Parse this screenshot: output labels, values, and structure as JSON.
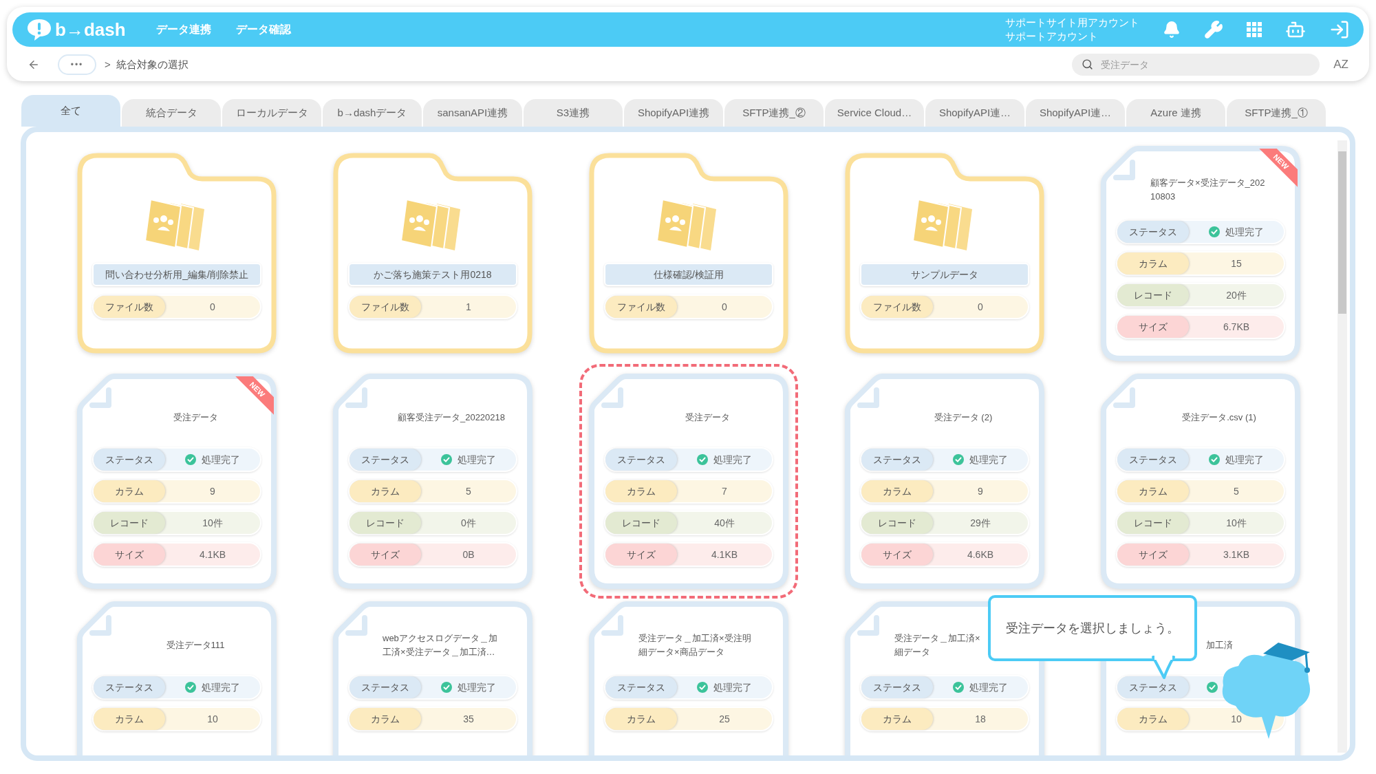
{
  "header": {
    "logo": "b→dash",
    "nav": [
      {
        "label": "データ連携"
      },
      {
        "label": "データ確認"
      }
    ],
    "account": [
      "サポートサイト用アカウント",
      "サポートアカウント"
    ]
  },
  "breadcrumb": {
    "ellipsis": "•••",
    "separator": ">",
    "current": "統合対象の選択"
  },
  "search": {
    "placeholder": "受注データ"
  },
  "sort_label": "AZ",
  "tabs": [
    {
      "label": "全て",
      "selected": true
    },
    {
      "label": "統合データ",
      "selected": false
    },
    {
      "label": "ローカルデータ",
      "selected": false
    },
    {
      "label": "b→dashデータ",
      "selected": false
    },
    {
      "label": "sansanAPI連携",
      "selected": false
    },
    {
      "label": "S3連携",
      "selected": false
    },
    {
      "label": "ShopifyAPI連携",
      "selected": false
    },
    {
      "label": "SFTP連携_②",
      "selected": false
    },
    {
      "label": "Service Cloud…",
      "selected": false
    },
    {
      "label": "ShopifyAPI連…",
      "selected": false
    },
    {
      "label": "ShopifyAPI連…",
      "selected": false
    },
    {
      "label": "Azure 連携",
      "selected": false
    },
    {
      "label": "SFTP連携_①",
      "selected": false
    }
  ],
  "cards": [
    {
      "kind": "folder",
      "name": "問い合わせ分析用_編集/削除禁止",
      "count_label": "ファイル数",
      "count": "0"
    },
    {
      "kind": "folder",
      "name": "かご落ち施策テスト用0218",
      "count_label": "ファイル数",
      "count": "1"
    },
    {
      "kind": "folder",
      "name": "仕様確認/検証用",
      "count_label": "ファイル数",
      "count": "0"
    },
    {
      "kind": "folder",
      "name": "サンプルデータ",
      "count_label": "ファイル数",
      "count": "0"
    },
    {
      "kind": "file",
      "title": [
        "顧客データ×受注データ_202",
        "10803"
      ],
      "badge": "NEW",
      "selected": false,
      "rows": [
        {
          "kind": "status",
          "label": "ステータス",
          "value": "処理完了"
        },
        {
          "kind": "column",
          "label": "カラム",
          "value": "15"
        },
        {
          "kind": "record",
          "label": "レコード",
          "value": "20件"
        },
        {
          "kind": "size",
          "label": "サイズ",
          "value": "6.7KB"
        }
      ]
    },
    {
      "kind": "file",
      "title": [
        "受注データ"
      ],
      "badge": "NEW",
      "selected": false,
      "rows": [
        {
          "kind": "status",
          "label": "ステータス",
          "value": "処理完了"
        },
        {
          "kind": "column",
          "label": "カラム",
          "value": "9"
        },
        {
          "kind": "record",
          "label": "レコード",
          "value": "10件"
        },
        {
          "kind": "size",
          "label": "サイズ",
          "value": "4.1KB"
        }
      ]
    },
    {
      "kind": "file",
      "title": [
        "顧客受注データ_20220218"
      ],
      "selected": false,
      "rows": [
        {
          "kind": "status",
          "label": "ステータス",
          "value": "処理完了"
        },
        {
          "kind": "column",
          "label": "カラム",
          "value": "5"
        },
        {
          "kind": "record",
          "label": "レコード",
          "value": "0件"
        },
        {
          "kind": "size",
          "label": "サイズ",
          "value": "0B"
        }
      ]
    },
    {
      "kind": "file",
      "title": [
        "受注データ"
      ],
      "selected": true,
      "rows": [
        {
          "kind": "status",
          "label": "ステータス",
          "value": "処理完了"
        },
        {
          "kind": "column",
          "label": "カラム",
          "value": "7"
        },
        {
          "kind": "record",
          "label": "レコード",
          "value": "40件"
        },
        {
          "kind": "size",
          "label": "サイズ",
          "value": "4.1KB"
        }
      ]
    },
    {
      "kind": "file",
      "title": [
        "受注データ (2)"
      ],
      "selected": false,
      "rows": [
        {
          "kind": "status",
          "label": "ステータス",
          "value": "処理完了"
        },
        {
          "kind": "column",
          "label": "カラム",
          "value": "9"
        },
        {
          "kind": "record",
          "label": "レコード",
          "value": "29件"
        },
        {
          "kind": "size",
          "label": "サイズ",
          "value": "4.6KB"
        }
      ]
    },
    {
      "kind": "file",
      "title": [
        "受注データ.csv (1)"
      ],
      "selected": false,
      "rows": [
        {
          "kind": "status",
          "label": "ステータス",
          "value": "処理完了"
        },
        {
          "kind": "column",
          "label": "カラム",
          "value": "5"
        },
        {
          "kind": "record",
          "label": "レコード",
          "value": "10件"
        },
        {
          "kind": "size",
          "label": "サイズ",
          "value": "3.1KB"
        }
      ]
    },
    {
      "kind": "file",
      "title": [
        "受注データ111"
      ],
      "selected": false,
      "rows": [
        {
          "kind": "status",
          "label": "ステータス",
          "value": "処理完了"
        },
        {
          "kind": "column",
          "label": "カラム",
          "value": "10"
        }
      ]
    },
    {
      "kind": "file",
      "title": [
        "webアクセスログデータ＿加",
        "工済×受注データ＿加工済…"
      ],
      "selected": false,
      "rows": [
        {
          "kind": "status",
          "label": "ステータス",
          "value": "処理完了"
        },
        {
          "kind": "column",
          "label": "カラム",
          "value": "35"
        }
      ]
    },
    {
      "kind": "file",
      "title": [
        "受注データ＿加工済×受注明",
        "細データ×商品データ"
      ],
      "selected": false,
      "rows": [
        {
          "kind": "status",
          "label": "ステータス",
          "value": "処理完了"
        },
        {
          "kind": "column",
          "label": "カラム",
          "value": "25"
        }
      ]
    },
    {
      "kind": "file",
      "title": [
        "受注データ＿加工済×",
        "細データ"
      ],
      "selected": false,
      "rows": [
        {
          "kind": "status",
          "label": "ステータス",
          "value": "処理完了"
        },
        {
          "kind": "column",
          "label": "カラム",
          "value": "18"
        }
      ]
    },
    {
      "kind": "file",
      "title": [
        "加工済"
      ],
      "selected": false,
      "rows": [
        {
          "kind": "status",
          "label": "ステータス"
        },
        {
          "kind": "column",
          "label": "カラム",
          "value": "10"
        }
      ]
    }
  ],
  "tip": {
    "text": "受注データを選択しましょう。"
  }
}
